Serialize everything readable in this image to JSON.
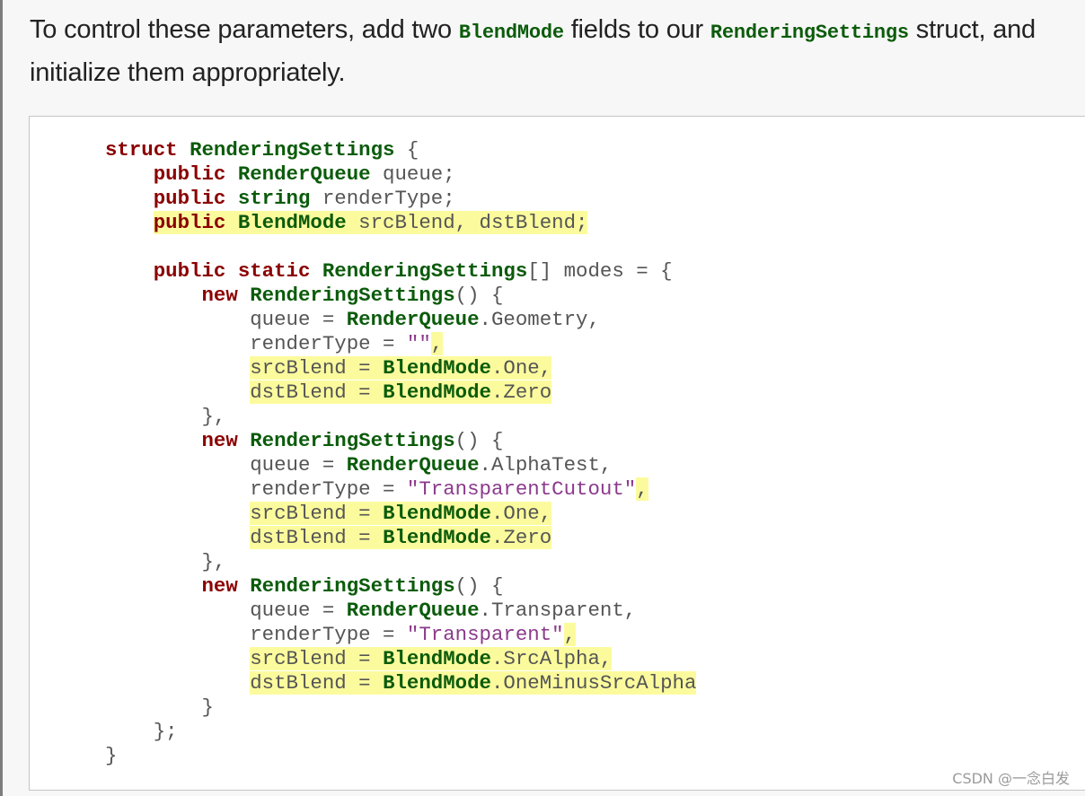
{
  "intro": {
    "part1": "To control these parameters, add two ",
    "code1": "BlendMode",
    "part2": " fields to our ",
    "code2": "RenderingSettings",
    "part3": " struct, and initialize them appropriately."
  },
  "code": {
    "lines": [
      [
        {
          "t": "struct",
          "c": "kw"
        },
        {
          "t": " "
        },
        {
          "t": "RenderingSettings",
          "c": "ty"
        },
        {
          "t": " {"
        }
      ],
      [
        {
          "t": "    "
        },
        {
          "t": "public",
          "c": "kw"
        },
        {
          "t": " "
        },
        {
          "t": "RenderQueue",
          "c": "ty"
        },
        {
          "t": " queue;"
        }
      ],
      [
        {
          "t": "    "
        },
        {
          "t": "public",
          "c": "kw"
        },
        {
          "t": " "
        },
        {
          "t": "string",
          "c": "ty"
        },
        {
          "t": " renderType;"
        }
      ],
      [
        {
          "t": "    "
        },
        {
          "t": "public",
          "c": "kw hl"
        },
        {
          "t": " ",
          "c": "hl"
        },
        {
          "t": "BlendMode",
          "c": "ty hl"
        },
        {
          "t": " srcBlend, dstBlend;",
          "c": "hl"
        }
      ],
      [
        {
          "t": ""
        }
      ],
      [
        {
          "t": "    "
        },
        {
          "t": "public",
          "c": "kw"
        },
        {
          "t": " "
        },
        {
          "t": "static",
          "c": "kw"
        },
        {
          "t": " "
        },
        {
          "t": "RenderingSettings",
          "c": "ty"
        },
        {
          "t": "[] modes = {"
        }
      ],
      [
        {
          "t": "        "
        },
        {
          "t": "new",
          "c": "kw"
        },
        {
          "t": " "
        },
        {
          "t": "RenderingSettings",
          "c": "ty"
        },
        {
          "t": "() {"
        }
      ],
      [
        {
          "t": "            queue = "
        },
        {
          "t": "RenderQueue",
          "c": "ty"
        },
        {
          "t": ".Geometry,"
        }
      ],
      [
        {
          "t": "            renderType = "
        },
        {
          "t": "\"\"",
          "c": "str"
        },
        {
          "t": ",",
          "c": "hl"
        }
      ],
      [
        {
          "t": "            "
        },
        {
          "t": "srcBlend = ",
          "c": "hl"
        },
        {
          "t": "BlendMode",
          "c": "ty hl"
        },
        {
          "t": ".One,",
          "c": "hl"
        }
      ],
      [
        {
          "t": "            "
        },
        {
          "t": "dstBlend = ",
          "c": "hl"
        },
        {
          "t": "BlendMode",
          "c": "ty hl"
        },
        {
          "t": ".Zero",
          "c": "hl"
        }
      ],
      [
        {
          "t": "        },"
        }
      ],
      [
        {
          "t": "        "
        },
        {
          "t": "new",
          "c": "kw"
        },
        {
          "t": " "
        },
        {
          "t": "RenderingSettings",
          "c": "ty"
        },
        {
          "t": "() {"
        }
      ],
      [
        {
          "t": "            queue = "
        },
        {
          "t": "RenderQueue",
          "c": "ty"
        },
        {
          "t": ".AlphaTest,"
        }
      ],
      [
        {
          "t": "            renderType = "
        },
        {
          "t": "\"TransparentCutout\"",
          "c": "str"
        },
        {
          "t": ",",
          "c": "hl"
        }
      ],
      [
        {
          "t": "            "
        },
        {
          "t": "srcBlend = ",
          "c": "hl"
        },
        {
          "t": "BlendMode",
          "c": "ty hl"
        },
        {
          "t": ".One,",
          "c": "hl"
        }
      ],
      [
        {
          "t": "            "
        },
        {
          "t": "dstBlend = ",
          "c": "hl"
        },
        {
          "t": "BlendMode",
          "c": "ty hl"
        },
        {
          "t": ".Zero",
          "c": "hl"
        }
      ],
      [
        {
          "t": "        },"
        }
      ],
      [
        {
          "t": "        "
        },
        {
          "t": "new",
          "c": "kw"
        },
        {
          "t": " "
        },
        {
          "t": "RenderingSettings",
          "c": "ty"
        },
        {
          "t": "() {"
        }
      ],
      [
        {
          "t": "            queue = "
        },
        {
          "t": "RenderQueue",
          "c": "ty"
        },
        {
          "t": ".Transparent,"
        }
      ],
      [
        {
          "t": "            renderType = "
        },
        {
          "t": "\"Transparent\"",
          "c": "str"
        },
        {
          "t": ",",
          "c": "hl"
        }
      ],
      [
        {
          "t": "            "
        },
        {
          "t": "srcBlend = ",
          "c": "hl"
        },
        {
          "t": "BlendMode",
          "c": "ty hl"
        },
        {
          "t": ".SrcAlpha,",
          "c": "hl"
        }
      ],
      [
        {
          "t": "            "
        },
        {
          "t": "dstBlend = ",
          "c": "hl"
        },
        {
          "t": "BlendMode",
          "c": "ty hl"
        },
        {
          "t": ".OneMinusSrcAlpha",
          "c": "hl"
        }
      ],
      [
        {
          "t": "        }"
        }
      ],
      [
        {
          "t": "    };"
        }
      ],
      [
        {
          "t": "}"
        }
      ]
    ]
  },
  "watermark": "CSDN @一念白发"
}
